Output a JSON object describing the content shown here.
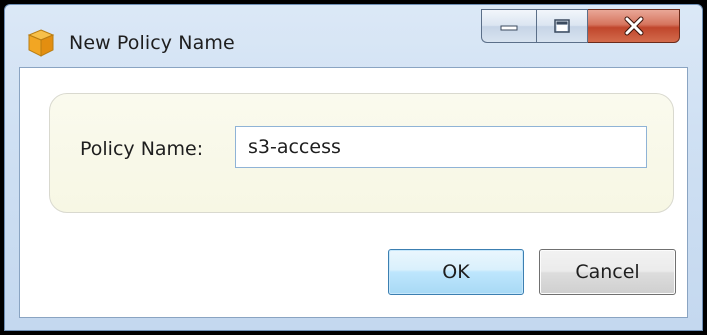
{
  "window": {
    "title": "New Policy Name",
    "icon": "box-icon",
    "caption_buttons": [
      "minimize-icon",
      "maximize-icon",
      "close-icon"
    ],
    "accent": "#c0462c"
  },
  "form": {
    "policy_name_label": "Policy Name:",
    "policy_name_value": "s3-access"
  },
  "buttons": {
    "ok_label": "OK",
    "cancel_label": "Cancel"
  },
  "colors": {
    "panel_background": "#f7f7e4",
    "ok_button": "#bee6fd",
    "cancel_button": "#dddddd"
  }
}
